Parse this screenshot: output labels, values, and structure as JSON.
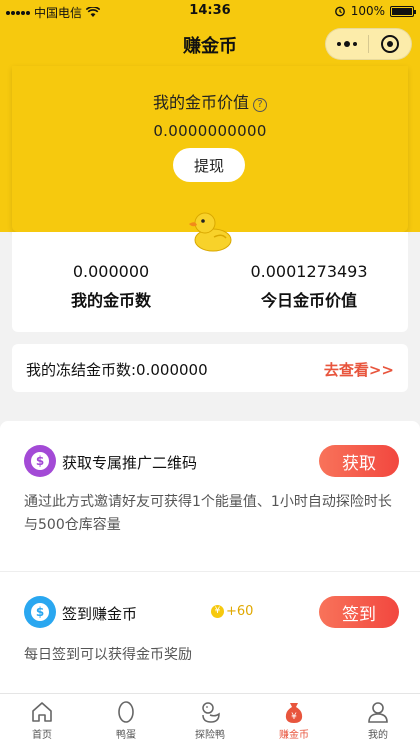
{
  "status_bar": {
    "carrier": "中国电信",
    "time": "14:36",
    "battery": "100%"
  },
  "nav": {
    "title": "赚金币"
  },
  "hero": {
    "label": "我的金币价值",
    "value": "0.0000000000",
    "withdraw_label": "提现"
  },
  "stats": {
    "coins_value": "0.000000",
    "coins_label": "我的金币数",
    "today_value": "0.0001273493",
    "today_label": "今日金币价值"
  },
  "frozen": {
    "text": "我的冻结金币数:0.000000",
    "link": "去查看>>"
  },
  "tasks": [
    {
      "title": "获取专属推广二维码",
      "button": "获取",
      "description": "通过此方式邀请好友可获得1个能量值、1小时自动探险时长与500仓库容量",
      "icon_color": "#a34ad6"
    },
    {
      "title": "签到赚金币",
      "button": "签到",
      "reward": "+60",
      "description": "每日签到可以获得金币奖励",
      "icon_color": "#2aa7f0"
    }
  ],
  "tabbar": {
    "items": [
      {
        "label": "首页",
        "icon": "home-icon"
      },
      {
        "label": "鸭蛋",
        "icon": "egg-icon"
      },
      {
        "label": "探险鸭",
        "icon": "duck-icon"
      },
      {
        "label": "赚金币",
        "icon": "money-bag-icon",
        "active": true
      },
      {
        "label": "我的",
        "icon": "user-icon"
      }
    ]
  },
  "colors": {
    "brand_yellow": "#f6c90e",
    "accent_red": "#e8553d"
  }
}
